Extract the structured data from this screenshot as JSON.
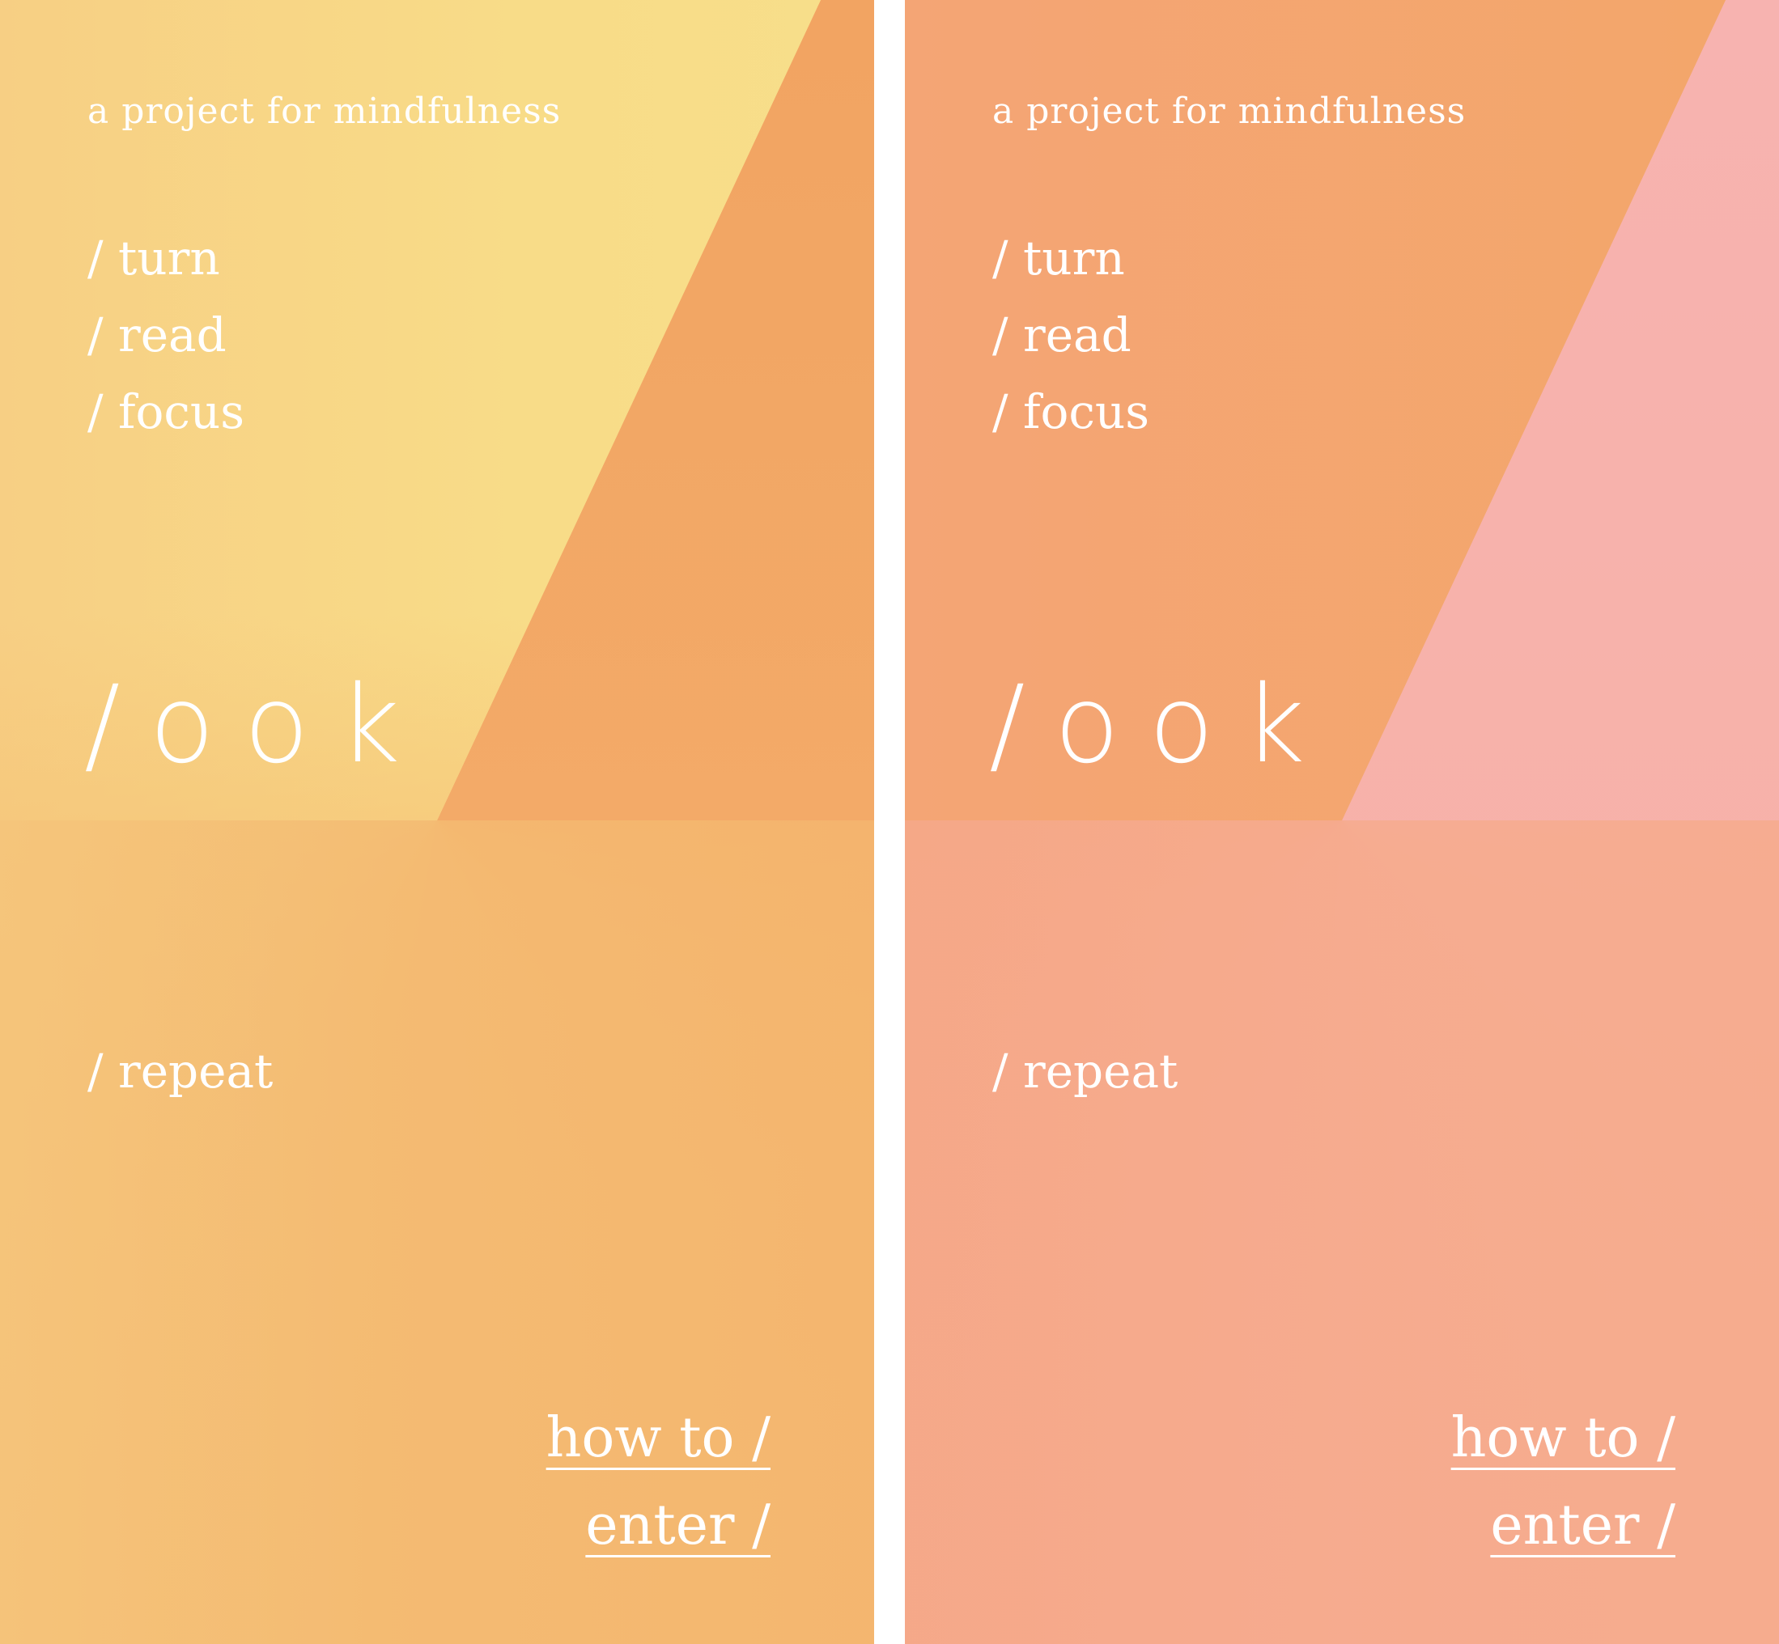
{
  "screens": [
    {
      "theme": "yellow-orange",
      "colors": {
        "wedge": "#f8dc88",
        "side": "#f2a462",
        "lower": "#f4b96f"
      },
      "tagline": "a project for mindfulness",
      "steps": [
        "/ turn",
        "/ read",
        "/ focus"
      ],
      "logo": "/ook",
      "repeat": "/ repeat",
      "links": {
        "how_to": "how to /",
        "enter": "enter /"
      }
    },
    {
      "theme": "orange-pink",
      "colors": {
        "wedge": "#f3a66a",
        "side": "#f7b2ae",
        "lower": "#f6aa8c"
      },
      "tagline": "a project for mindfulness",
      "steps": [
        "/ turn",
        "/ read",
        "/ focus"
      ],
      "logo": "/ook",
      "repeat": "/ repeat",
      "links": {
        "how_to": "how to /",
        "enter": "enter /"
      }
    }
  ]
}
